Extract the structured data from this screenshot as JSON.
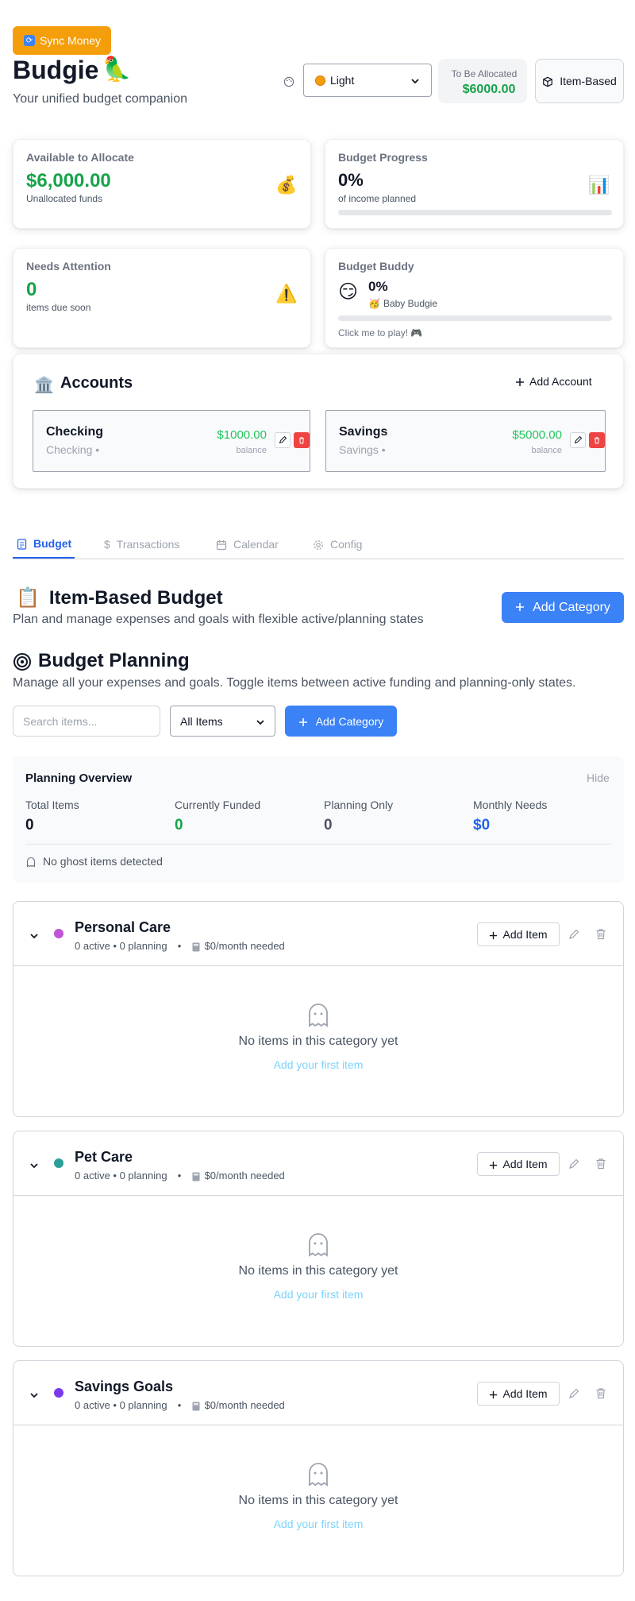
{
  "header": {
    "sync_label": "Sync Money",
    "app_name": "Budgie",
    "app_logo": "🦜",
    "subtitle": "Your unified budget companion",
    "theme_value": "Light",
    "to_be_allocated_label": "To Be Allocated",
    "to_be_allocated_value": "$6000.00",
    "mode_label": "Item-Based"
  },
  "cards": {
    "available": {
      "title": "Available to Allocate",
      "value": "$6,000.00",
      "note": "Unallocated funds",
      "icon": "💰"
    },
    "progress": {
      "title": "Budget Progress",
      "value": "0%",
      "note": "of income planned",
      "icon": "📊",
      "fill_percent": 0
    },
    "attention": {
      "title": "Needs Attention",
      "value": "0",
      "note": "items due soon",
      "icon": "⚠️"
    },
    "buddy": {
      "title": "Budget Buddy",
      "value": "0%",
      "face": "😏",
      "pet_emoji": "🥳",
      "pet_name": "Baby Budgie",
      "hint": "Click me to play! 🎮",
      "fill_percent": 0
    }
  },
  "accounts": {
    "title": "Accounts",
    "icon": "🏛️",
    "add_label": "Add Account",
    "items": [
      {
        "name": "Checking",
        "type": "Checking •",
        "balance": "$1000.00",
        "balance_label": "balance"
      },
      {
        "name": "Savings",
        "type": "Savings •",
        "balance": "$5000.00",
        "balance_label": "balance"
      }
    ]
  },
  "tabs": [
    {
      "label": "Budget",
      "active": true
    },
    {
      "label": "Transactions",
      "active": false
    },
    {
      "label": "Calendar",
      "active": false
    },
    {
      "label": "Config",
      "active": false
    }
  ],
  "item_budget": {
    "icon": "📋",
    "title": "Item-Based Budget",
    "subtitle": "Plan and manage expenses and goals with flexible active/planning states",
    "add_category_label": "Add Category"
  },
  "planning": {
    "icon": "🎯",
    "title": "Budget Planning",
    "subtitle": "Manage all your expenses and goals. Toggle items between active funding and planning-only states.",
    "search_placeholder": "Search items...",
    "filter_value": "All Items",
    "add_category_label": "Add Category"
  },
  "overview": {
    "title": "Planning Overview",
    "hide_label": "Hide",
    "stats": [
      {
        "label": "Total Items",
        "value": "0",
        "color": "#111827"
      },
      {
        "label": "Currently Funded",
        "value": "0",
        "color": "#16a34a"
      },
      {
        "label": "Planning Only",
        "value": "0",
        "color": "#4b5563"
      },
      {
        "label": "Monthly Needs",
        "value": "$0",
        "color": "#2563eb"
      }
    ],
    "ghost_text": "No ghost items detected"
  },
  "categories": [
    {
      "name": "Personal Care",
      "dot_color": "#c056d6",
      "counts": "0 active • 0 planning",
      "needed": "$0/month needed",
      "add_label": "Add Item",
      "empty_text": "No items in this category yet",
      "empty_link": "Add your first item"
    },
    {
      "name": "Pet Care",
      "dot_color": "#2aa198",
      "counts": "0 active • 0 planning",
      "needed": "$0/month needed",
      "add_label": "Add Item",
      "empty_text": "No items in this category yet",
      "empty_link": "Add your first item"
    },
    {
      "name": "Savings Goals",
      "dot_color": "#7c3aed",
      "counts": "0 active • 0 planning",
      "needed": "$0/month needed",
      "add_label": "Add Item",
      "empty_text": "No items in this category yet",
      "empty_link": "Add your first item"
    }
  ]
}
